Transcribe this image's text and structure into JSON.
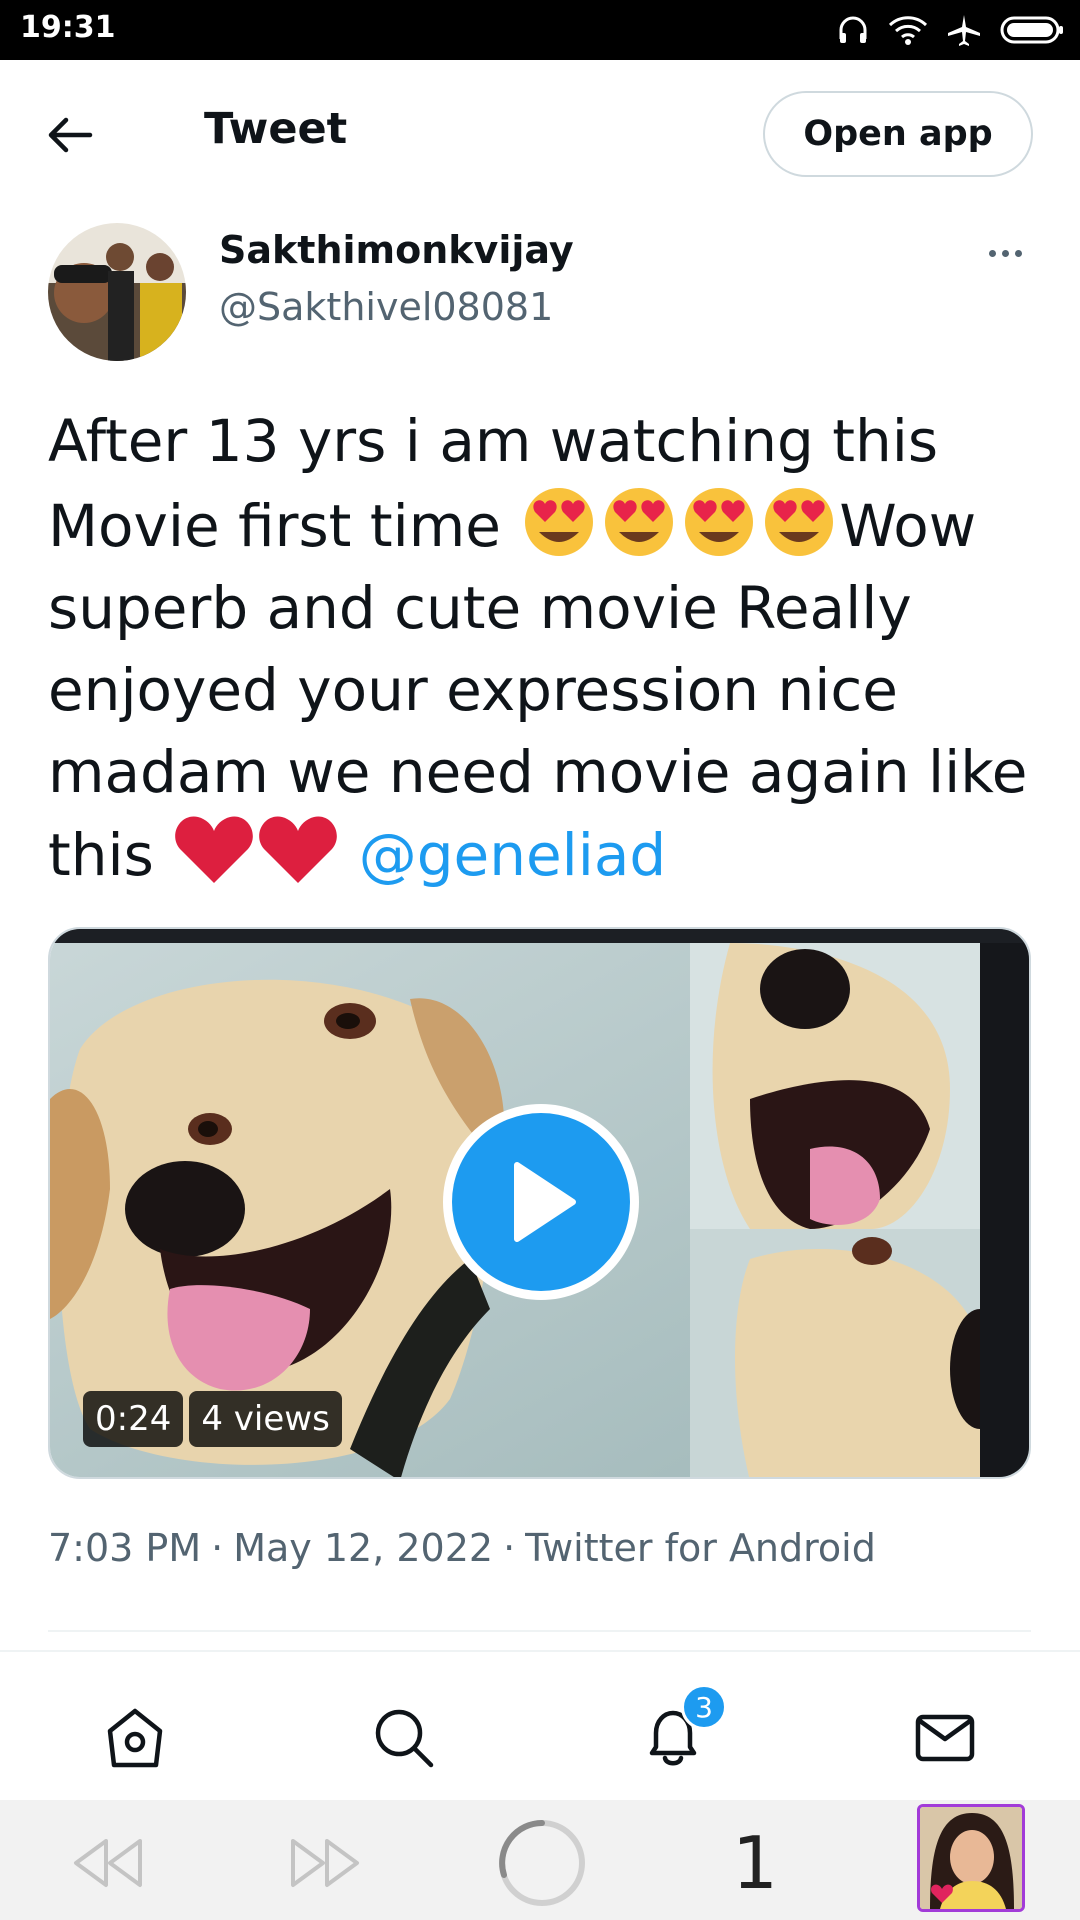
{
  "status_bar": {
    "time": "19:31",
    "icons": [
      "headphones-icon",
      "wifi-icon",
      "airplane-mode-icon",
      "battery-icon"
    ]
  },
  "header": {
    "title": "Tweet",
    "open_app_label": "Open app"
  },
  "tweet": {
    "display_name": "Sakthimonkvijay",
    "handle": "@Sakthivel08081",
    "text_part1": "After 13 yrs i am watching this Movie first time ",
    "text_part2": "Wow superb and cute movie Really enjoyed your expression nice madam we need movie again like this ",
    "mention": "@geneliad",
    "emoji_smiling_hearts_count": 4,
    "emoji_red_heart_count": 2,
    "media": {
      "duration": "0:24",
      "views": "4 views"
    },
    "time": "7:03 PM",
    "date": "May 12, 2022",
    "source": "Twitter for Android",
    "separator": "·"
  },
  "bottom_nav": {
    "items": [
      "home-icon",
      "search-icon",
      "notifications-icon",
      "messages-icon"
    ],
    "notification_count": "3"
  },
  "system_bar": {
    "tab_count": "1"
  },
  "colors": {
    "accent": "#1d9bf0",
    "text_primary": "#0f1419",
    "text_secondary": "#536471",
    "border": "#cfd9de",
    "heart": "#e0245e"
  }
}
